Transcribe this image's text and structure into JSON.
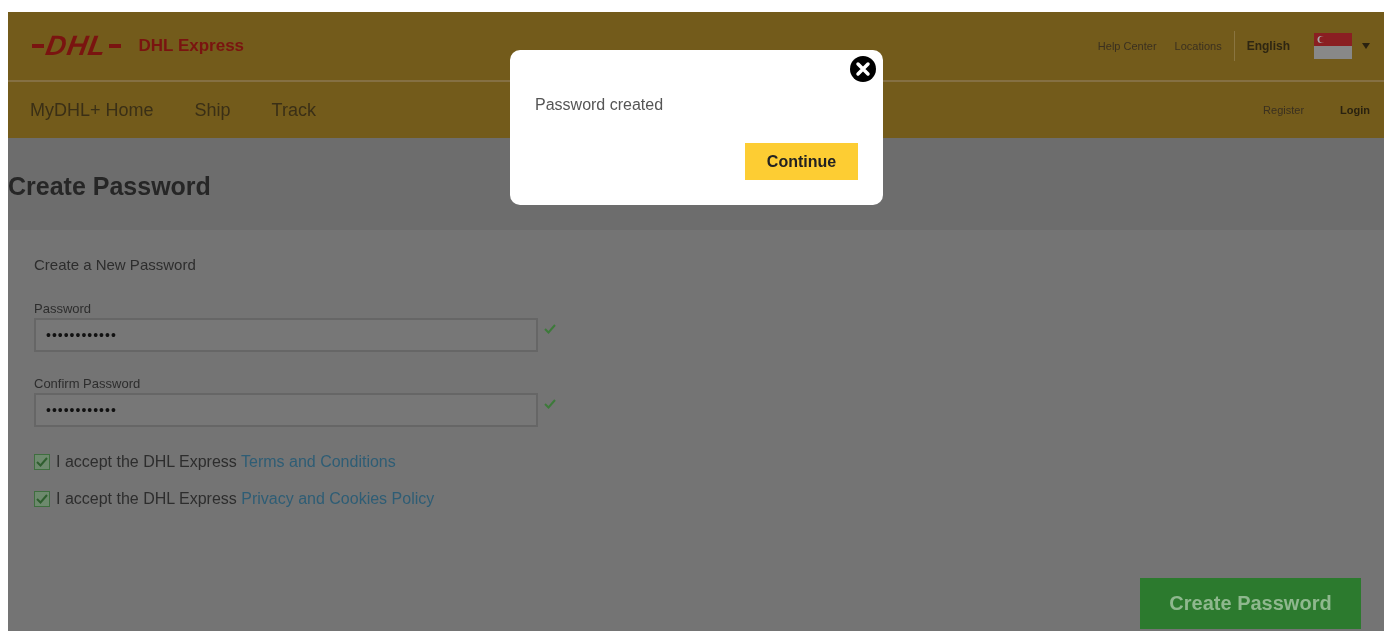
{
  "header": {
    "logo_text": "DHL",
    "brand": "DHL Express",
    "utility_links": [
      "Help Center",
      "Locations"
    ],
    "language": "English"
  },
  "nav": {
    "items": [
      "MyDHL+ Home",
      "Ship",
      "Track"
    ],
    "account_links": [
      {
        "label": "Register",
        "emphasized": false
      },
      {
        "label": "Login",
        "emphasized": true
      }
    ]
  },
  "page_title": "Create Password",
  "form": {
    "heading": "Create a New Password",
    "fields": [
      {
        "label": "Password",
        "value": "••••••••••••",
        "valid": true
      },
      {
        "label": "Confirm Password",
        "value": "••••••••••••",
        "valid": true
      }
    ],
    "agreements": [
      {
        "text": "I accept the DHL Express ",
        "link": "Terms and Conditions",
        "checked": true
      },
      {
        "text": "I accept the DHL Express ",
        "link": "Privacy and Cookies Policy",
        "checked": true
      }
    ],
    "submit": "Create Password"
  },
  "dialog": {
    "message": "Password created",
    "button": "Continue"
  }
}
